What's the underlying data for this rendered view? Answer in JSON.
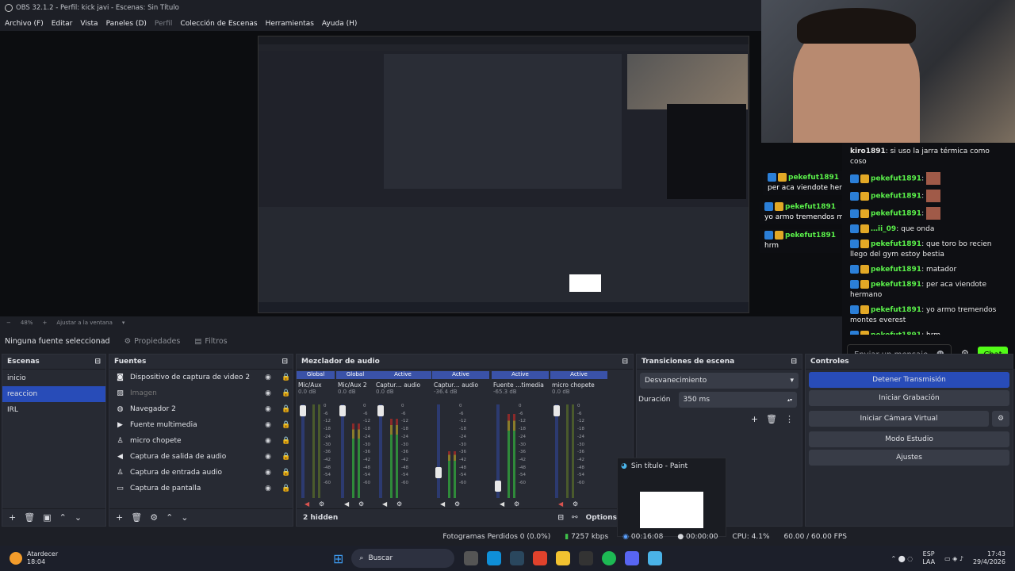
{
  "app": {
    "title": "OBS 32.1.2 - Perfil: kick javi - Escenas: Sin Título"
  },
  "menu": [
    "Archivo (F)",
    "Editar",
    "Vista",
    "Paneles (D)",
    "Perfil",
    "Colección de Escenas",
    "Herramientas",
    "Ayuda (H)"
  ],
  "zoom": {
    "level": "48%",
    "fit": "Ajustar a la ventana"
  },
  "source_bar": {
    "none": "Ninguna fuente seleccionad",
    "props": "Propiedades",
    "filters": "Filtros"
  },
  "scenes": {
    "title": "Escenas",
    "items": [
      "inicio",
      "reaccion",
      "IRL"
    ],
    "selected": 1
  },
  "sources": {
    "title": "Fuentes",
    "items": [
      {
        "icon": "camera-icon",
        "label": "Dispositivo de captura de video 2",
        "dim": false
      },
      {
        "icon": "image-icon",
        "label": "Imagen",
        "dim": true
      },
      {
        "icon": "globe-icon",
        "label": "Navegador 2",
        "dim": false
      },
      {
        "icon": "play-icon",
        "label": "Fuente multimedia",
        "dim": false
      },
      {
        "icon": "mic-icon",
        "label": "micro chopete",
        "dim": false
      },
      {
        "icon": "speaker-icon",
        "label": "Captura de salida de audio",
        "dim": false
      },
      {
        "icon": "mic-icon",
        "label": "Captura de entrada audio",
        "dim": false
      },
      {
        "icon": "monitor-icon",
        "label": "Captura de pantalla",
        "dim": false
      }
    ]
  },
  "mixer": {
    "title": "Mezclador de audio",
    "hidden": "2 hidden",
    "options": "Options",
    "channels": [
      {
        "group": "Global",
        "name": "Mic/Aux",
        "db": "0.0 dB",
        "level": 0,
        "fader": 0.96
      },
      {
        "group": "Global",
        "name": "Mic/Aux 2",
        "db": "0.0 dB",
        "level": 0.8,
        "fader": 0.96
      },
      {
        "group": "Active",
        "name": "Captur… audio",
        "db": "0.0 dB",
        "level": 0.85,
        "fader": 0.96
      },
      {
        "group": "Active",
        "name": "Captur… audio",
        "db": "-36.4 dB",
        "level": 0.5,
        "fader": 0.3
      },
      {
        "group": "Active",
        "name": "Fuente …timedia",
        "db": "-65.3 dB",
        "level": 0.9,
        "fader": 0.15
      },
      {
        "group": "Active",
        "name": "micro chopete",
        "db": "0.0 dB",
        "level": 0,
        "fader": 0.96
      }
    ],
    "scale": [
      "0",
      "-6",
      "-12",
      "-18",
      "-24",
      "-30",
      "-36",
      "-42",
      "-48",
      "-54",
      "-60"
    ]
  },
  "transitions": {
    "title": "Transiciones de escena",
    "type": "Desvanecimiento",
    "duration_label": "Duración",
    "duration": "350 ms"
  },
  "controls": {
    "title": "Controles",
    "stop_stream": "Detener Transmisión",
    "start_rec": "Iniciar Grabación",
    "virtual_cam": "Iniciar Cámara Virtual",
    "studio": "Modo Estudio",
    "settings": "Ajustes"
  },
  "status": {
    "frames": "Fotogramas Perdidos 0 (0.0%)",
    "kbps": "7257 kbps",
    "stream_time": "00:16:08",
    "rec_time": "00:00:00",
    "cpu": "CPU: 4.1%",
    "fps": "60.00 / 60.00 FPS"
  },
  "paint_popup": {
    "title": "Sin título - Paint"
  },
  "chat": {
    "messages": [
      {
        "user": "kiro1891",
        "text": "si uso la jarra térmica como coso",
        "badges": false,
        "nocolor": true
      },
      {
        "user": "pekefut1891",
        "text": "",
        "badges": true
      },
      {
        "user": "pekefut1891",
        "text": "",
        "badges": true
      },
      {
        "user": "pekefut1891",
        "text": "",
        "badges": true
      },
      {
        "user": "…ii_09",
        "text": "que onda",
        "badges": true
      },
      {
        "user": "pekefut1891",
        "text": "que toro bo recien llego del gym estoy bestia",
        "badges": true
      },
      {
        "user": "pekefut1891",
        "text": "matador",
        "badges": true
      },
      {
        "user": "pekefut1891",
        "text": "per aca viendote hermano",
        "badges": true
      },
      {
        "user": "pekefut1891",
        "text": "yo armo tremendos montes everest",
        "badges": true
      },
      {
        "user": "pekefut1891",
        "text": "hrm",
        "badges": true
      }
    ],
    "placeholder": "Enviar un mensaje",
    "send": "Chat"
  },
  "overlay_msgs": [
    {
      "user": "pekefut1891",
      "text": "per aca viendote hermano"
    },
    {
      "user": "pekefut1891",
      "text": "yo armo tremendos montes everest"
    },
    {
      "user": "pekefut1891",
      "text": "hrm"
    }
  ],
  "taskbar": {
    "weather_title": "Atardecer",
    "weather_time": "18:04",
    "search": "Buscar",
    "lang1": "ESP",
    "lang2": "LAA",
    "time": "17:43",
    "date": "29/4/2026"
  }
}
